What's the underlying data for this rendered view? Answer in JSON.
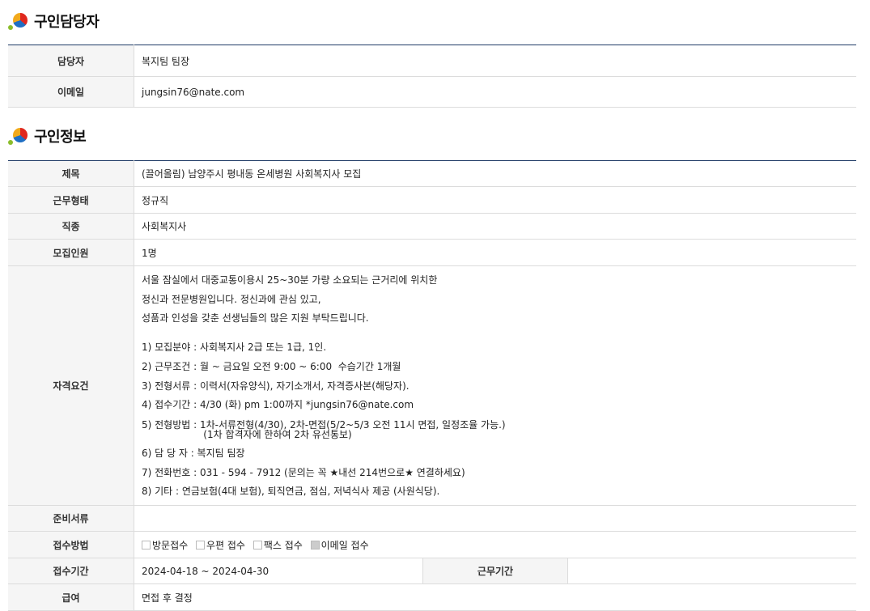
{
  "contact": {
    "title": "구인담당자",
    "rows": [
      {
        "label": "담당자",
        "value": "복지팀 팀장"
      },
      {
        "label": "이메일",
        "value": "jungsin76@nate.com"
      }
    ]
  },
  "job": {
    "title": "구인정보",
    "subject_label": "제목",
    "subject_value": "(끌어올림) 남양주시 평내동 온세병원 사회복지사 모집",
    "worktype_label": "근무형태",
    "worktype_value": "정규직",
    "jobtype_label": "직종",
    "jobtype_value": "사회복지사",
    "headcount_label": "모집인원",
    "headcount_value": "1명",
    "qual_label": "자격요건",
    "qual_lines": [
      "서울 잠실에서 대중교통이용시 25~30분 가량 소요되는 근거리에 위치한",
      "정신과 전문병원입니다. 정신과에 관심 있고,",
      "성품과 인성을 갖춘 선생님들의 많은 지원 부탁드립니다.",
      "1) 모집분야 : 사회복지사 2급 또는 1급, 1인.",
      "2) 근무조건 : 월 ~ 금요일 오전 9:00 ~ 6:00  수습기간 1개월",
      "3) 전형서류 : 이력서(자유양식), 자기소개서, 자격증사본(해당자).",
      "4) 접수기간 : 4/30 (화) pm 1:00까지 *jungsin76@nate.com",
      "5) 전형방법 : 1차-서류전형(4/30), 2차-면접(5/2~5/3 오전 11시 면접, 일정조율 가능.)",
      "                    (1차 합격자에 한하여 2차 유선통보)",
      "6) 담 당 자 : 복지팀 팀장",
      "7) 전화번호 : 031 - 594 - 7912 (문의는 꼭 ★내선 214번으로★ 연결하세요)",
      "8) 기타 : 연금보험(4대 보험), 퇴직연금, 점심, 저녁식사 제공 (사원식당)."
    ],
    "docs_label": "준비서류",
    "docs_value": "",
    "method_label": "접수방법",
    "methods": [
      {
        "label": "방문접수",
        "checked": false
      },
      {
        "label": "우편 접수",
        "checked": false
      },
      {
        "label": "팩스 접수",
        "checked": false
      },
      {
        "label": "이메일 접수",
        "checked": true
      }
    ],
    "period_label": "접수기간",
    "period_value": "2024-04-18 ~ 2024-04-30",
    "workperiod_label": "근무기간",
    "workperiod_value": "",
    "salary_label": "급여",
    "salary_value": "면접 후 결정"
  }
}
